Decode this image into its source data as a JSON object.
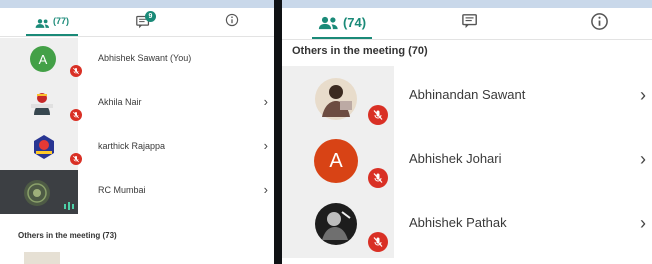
{
  "left_panel": {
    "tabs": {
      "people_count": "(77)",
      "chat_badge": "9"
    },
    "participants": [
      {
        "name": "Abhishek Sawant (You)",
        "avatar_letter": "A",
        "avatar_color": "#43a047",
        "status": "muted"
      },
      {
        "name": "Akhila Nair",
        "avatar_letter": "",
        "status": "muted"
      },
      {
        "name": "karthick Rajappa",
        "avatar_letter": "",
        "status": "muted"
      },
      {
        "name": "RC Mumbai",
        "avatar_letter": "",
        "status": "speaking"
      }
    ],
    "section_title": "Others in the meeting (73)"
  },
  "right_panel": {
    "tabs": {
      "people_count": "(74)"
    },
    "section_title": "Others in the meeting (70)",
    "participants": [
      {
        "name": "Abhinandan Sawant",
        "avatar_letter": "",
        "status": "muted"
      },
      {
        "name": "Abhishek Johari",
        "avatar_letter": "A",
        "avatar_color": "#d84315",
        "status": "muted"
      },
      {
        "name": "Abhishek Pathak",
        "avatar_letter": "",
        "status": "muted"
      }
    ]
  },
  "colors": {
    "accent": "#1a8a78",
    "mute_red": "#d93025",
    "thumb_bg": "#efefef"
  }
}
